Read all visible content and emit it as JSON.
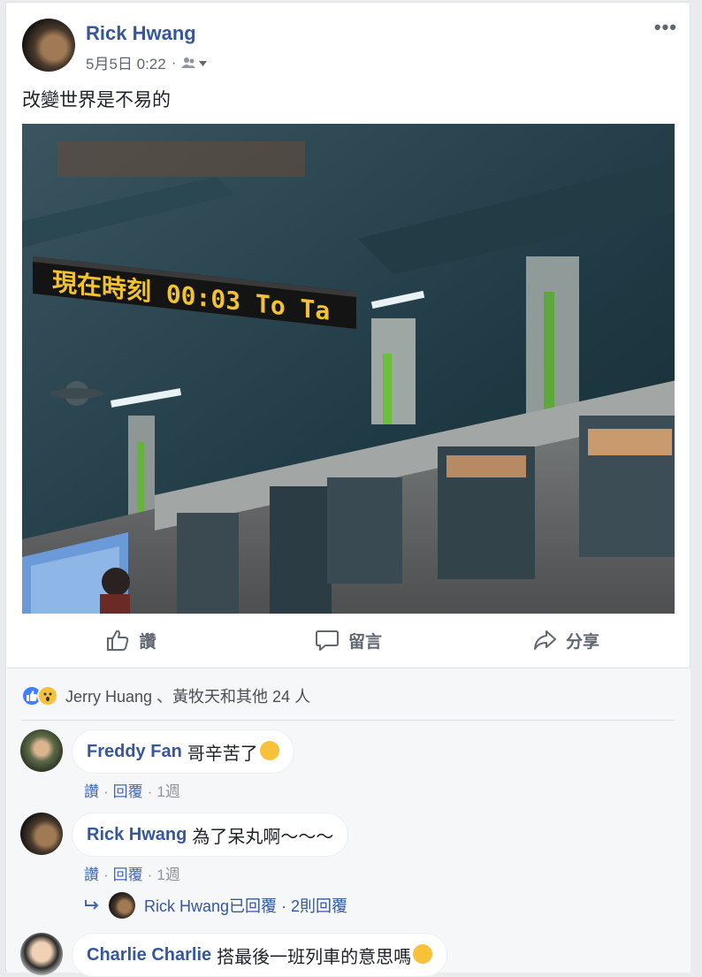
{
  "post": {
    "author": "Rick Hwang",
    "timestamp": "5月5日 0:22",
    "meta_separator": "·",
    "privacy_icon": "friends-icon",
    "more_label": "•••",
    "text": "改變世界是不易的"
  },
  "photo": {
    "sign_text": "現在時刻 00:03 To Ta"
  },
  "actions": {
    "like": "讚",
    "comment": "留言",
    "share": "分享"
  },
  "reactions": {
    "icons": [
      "like-icon",
      "wow-icon"
    ],
    "text": "Jerry Huang 、黃牧天和其他 24 人"
  },
  "comments": [
    {
      "name": "Freddy Fan",
      "text": "哥辛苦了",
      "emoji": "sleepy-emoji",
      "like": "讚",
      "reply": "回覆",
      "time": "1週"
    },
    {
      "name": "Rick Hwang",
      "text": "為了呆丸啊～～～",
      "like": "讚",
      "reply": "回覆",
      "time": "1週"
    },
    {
      "name": "Charlie Charlie",
      "text": "搭最後一班列車的意思嗎",
      "emoji": "grin-emoji"
    }
  ],
  "replies_summary": {
    "text": "Rick Hwang已回覆 · 2則回覆"
  },
  "colors": {
    "link": "#365899",
    "action_text": "#606770",
    "sign_led": "#f2c230",
    "like_blue": "#4080ff"
  }
}
